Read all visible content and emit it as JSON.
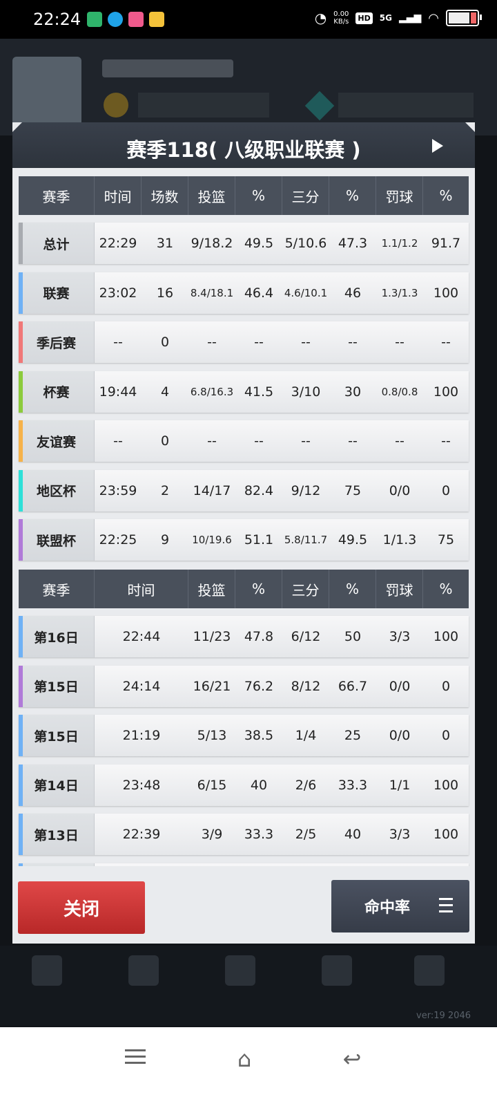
{
  "status_bar": {
    "time": "22:24",
    "net_speed_value": "0.00",
    "net_speed_unit": "KB/s",
    "hd_badge": "HD",
    "network": "5G"
  },
  "background": {
    "version": "ver:19  2046"
  },
  "modal": {
    "title": "赛季118( 八级职业联赛 )",
    "summary": {
      "headers": [
        "赛季",
        "时间",
        "场数",
        "投篮",
        "%",
        "三分",
        "%",
        "罚球",
        "%"
      ],
      "rows": [
        {
          "accent": "#a8abb0",
          "cells": [
            "总计",
            "22:29",
            "31",
            "9/18.2",
            "49.5",
            "5/10.6",
            "47.3",
            "1.1/1.2",
            "91.7"
          ]
        },
        {
          "accent": "#6fb1f5",
          "cells": [
            "联赛",
            "23:02",
            "16",
            "8.4/18.1",
            "46.4",
            "4.6/10.1",
            "46",
            "1.3/1.3",
            "100"
          ]
        },
        {
          "accent": "#f07878",
          "cells": [
            "季后赛",
            "--",
            "0",
            "--",
            "--",
            "--",
            "--",
            "--",
            "--"
          ]
        },
        {
          "accent": "#8ccb3c",
          "cells": [
            "杯赛",
            "19:44",
            "4",
            "6.8/16.3",
            "41.5",
            "3/10",
            "30",
            "0.8/0.8",
            "100"
          ]
        },
        {
          "accent": "#f6b24a",
          "cells": [
            "友谊赛",
            "--",
            "0",
            "--",
            "--",
            "--",
            "--",
            "--",
            "--"
          ]
        },
        {
          "accent": "#2ee0d8",
          "cells": [
            "地区杯",
            "23:59",
            "2",
            "14/17",
            "82.4",
            "9/12",
            "75",
            "0/0",
            "0"
          ]
        },
        {
          "accent": "#b07ad8",
          "cells": [
            "联盟杯",
            "22:25",
            "9",
            "10/19.6",
            "51.1",
            "5.8/11.7",
            "49.5",
            "1/1.3",
            "75"
          ]
        }
      ]
    },
    "games": {
      "headers": [
        "赛季",
        "时间",
        "投篮",
        "%",
        "三分",
        "%",
        "罚球",
        "%"
      ],
      "rows": [
        {
          "accent": "#6fb1f5",
          "cells": [
            "第16日",
            "22:44",
            "11/23",
            "47.8",
            "6/12",
            "50",
            "3/3",
            "100"
          ]
        },
        {
          "accent": "#b07ad8",
          "cells": [
            "第15日",
            "24:14",
            "16/21",
            "76.2",
            "8/12",
            "66.7",
            "0/0",
            "0"
          ]
        },
        {
          "accent": "#6fb1f5",
          "cells": [
            "第15日",
            "21:19",
            "5/13",
            "38.5",
            "1/4",
            "25",
            "0/0",
            "0"
          ]
        },
        {
          "accent": "#6fb1f5",
          "cells": [
            "第14日",
            "23:48",
            "6/15",
            "40",
            "2/6",
            "33.3",
            "1/1",
            "100"
          ]
        },
        {
          "accent": "#6fb1f5",
          "cells": [
            "第13日",
            "22:39",
            "3/9",
            "33.3",
            "2/5",
            "40",
            "3/3",
            "100"
          ]
        },
        {
          "accent": "#6fb1f5",
          "cells": [
            "",
            "",
            "",
            "",
            "",
            "",
            "",
            ""
          ]
        }
      ]
    },
    "close_label": "关闭",
    "sort_label": "命中率"
  },
  "colors": {
    "close_button": "#d23a3a",
    "header_bg": "#49505b",
    "sort_button": "#40465a"
  }
}
